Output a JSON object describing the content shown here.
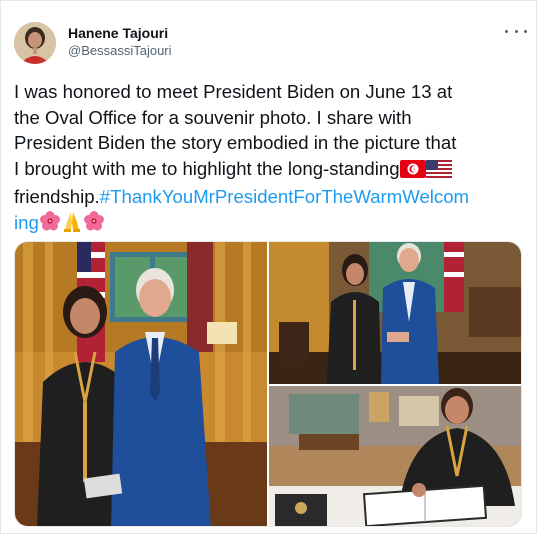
{
  "author": {
    "name": "Hanene Tajouri",
    "handle": "@BessassiTajouri"
  },
  "tweet": {
    "line1": "I was honored to meet President Biden on June 13 at",
    "line2": "the Oval Office for a souvenir photo. I share with",
    "line3": "President Biden the story embodied in the picture that",
    "line4": "I brought with me to highlight the long-standing",
    "line5_text": "friendship.",
    "hashtag_part1": "#ThankYouMrPresidentForTheWarmWelcom",
    "hashtag_part2": "ing"
  },
  "icons": {
    "more": "more-options-icon",
    "flag_tunisia": "tunisia-flag-icon",
    "flag_usa": "usa-flag-icon",
    "hibiscus": "hibiscus-icon",
    "praying_hands": "folded-hands-icon"
  },
  "colors": {
    "link": "#1d9bf0",
    "handle": "#536471",
    "text": "#0f1419"
  }
}
